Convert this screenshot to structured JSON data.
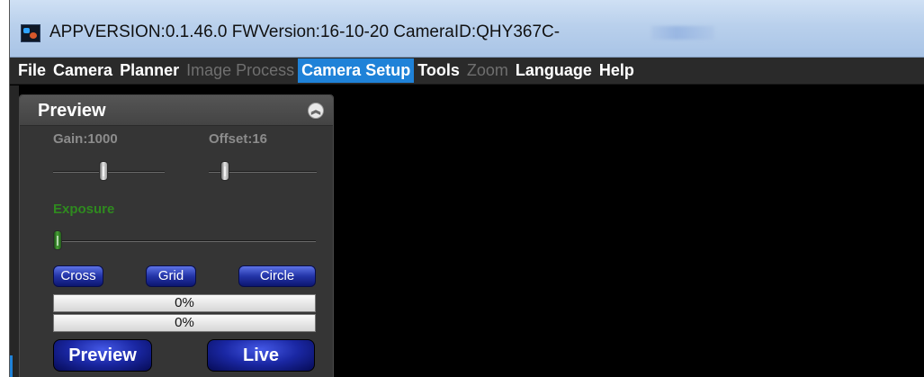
{
  "window": {
    "title": "APPVERSION:0.1.46.0  FWVersion:16-10-20  CameraID:QHY367C-"
  },
  "menu": {
    "items": [
      {
        "label": "File",
        "state": "enabled"
      },
      {
        "label": "Camera",
        "state": "enabled"
      },
      {
        "label": "Planner",
        "state": "enabled"
      },
      {
        "label": "Image Process",
        "state": "disabled"
      },
      {
        "label": "Camera Setup",
        "state": "active"
      },
      {
        "label": "Tools",
        "state": "enabled"
      },
      {
        "label": "Zoom",
        "state": "disabled"
      },
      {
        "label": "Language",
        "state": "enabled"
      },
      {
        "label": "Help",
        "state": "enabled"
      }
    ]
  },
  "preview_panel": {
    "title": "Preview",
    "collapse_icon": "double-chevron-up-icon",
    "gain": {
      "label": "Gain:1000",
      "level": 0.45
    },
    "offset": {
      "label": "Offset:16",
      "level": 0.12
    },
    "exposure": {
      "label": "Exposure",
      "level": 0.0
    },
    "overlay_buttons": [
      "Cross",
      "Grid",
      "Circle"
    ],
    "progress_1": "0%",
    "progress_2": "0%",
    "preview_button": "Preview",
    "live_button": "Live"
  },
  "colors": {
    "menu_active": "#1f82d8",
    "exposure_label": "#2f8a1f",
    "button_blue": "#2334a8"
  }
}
